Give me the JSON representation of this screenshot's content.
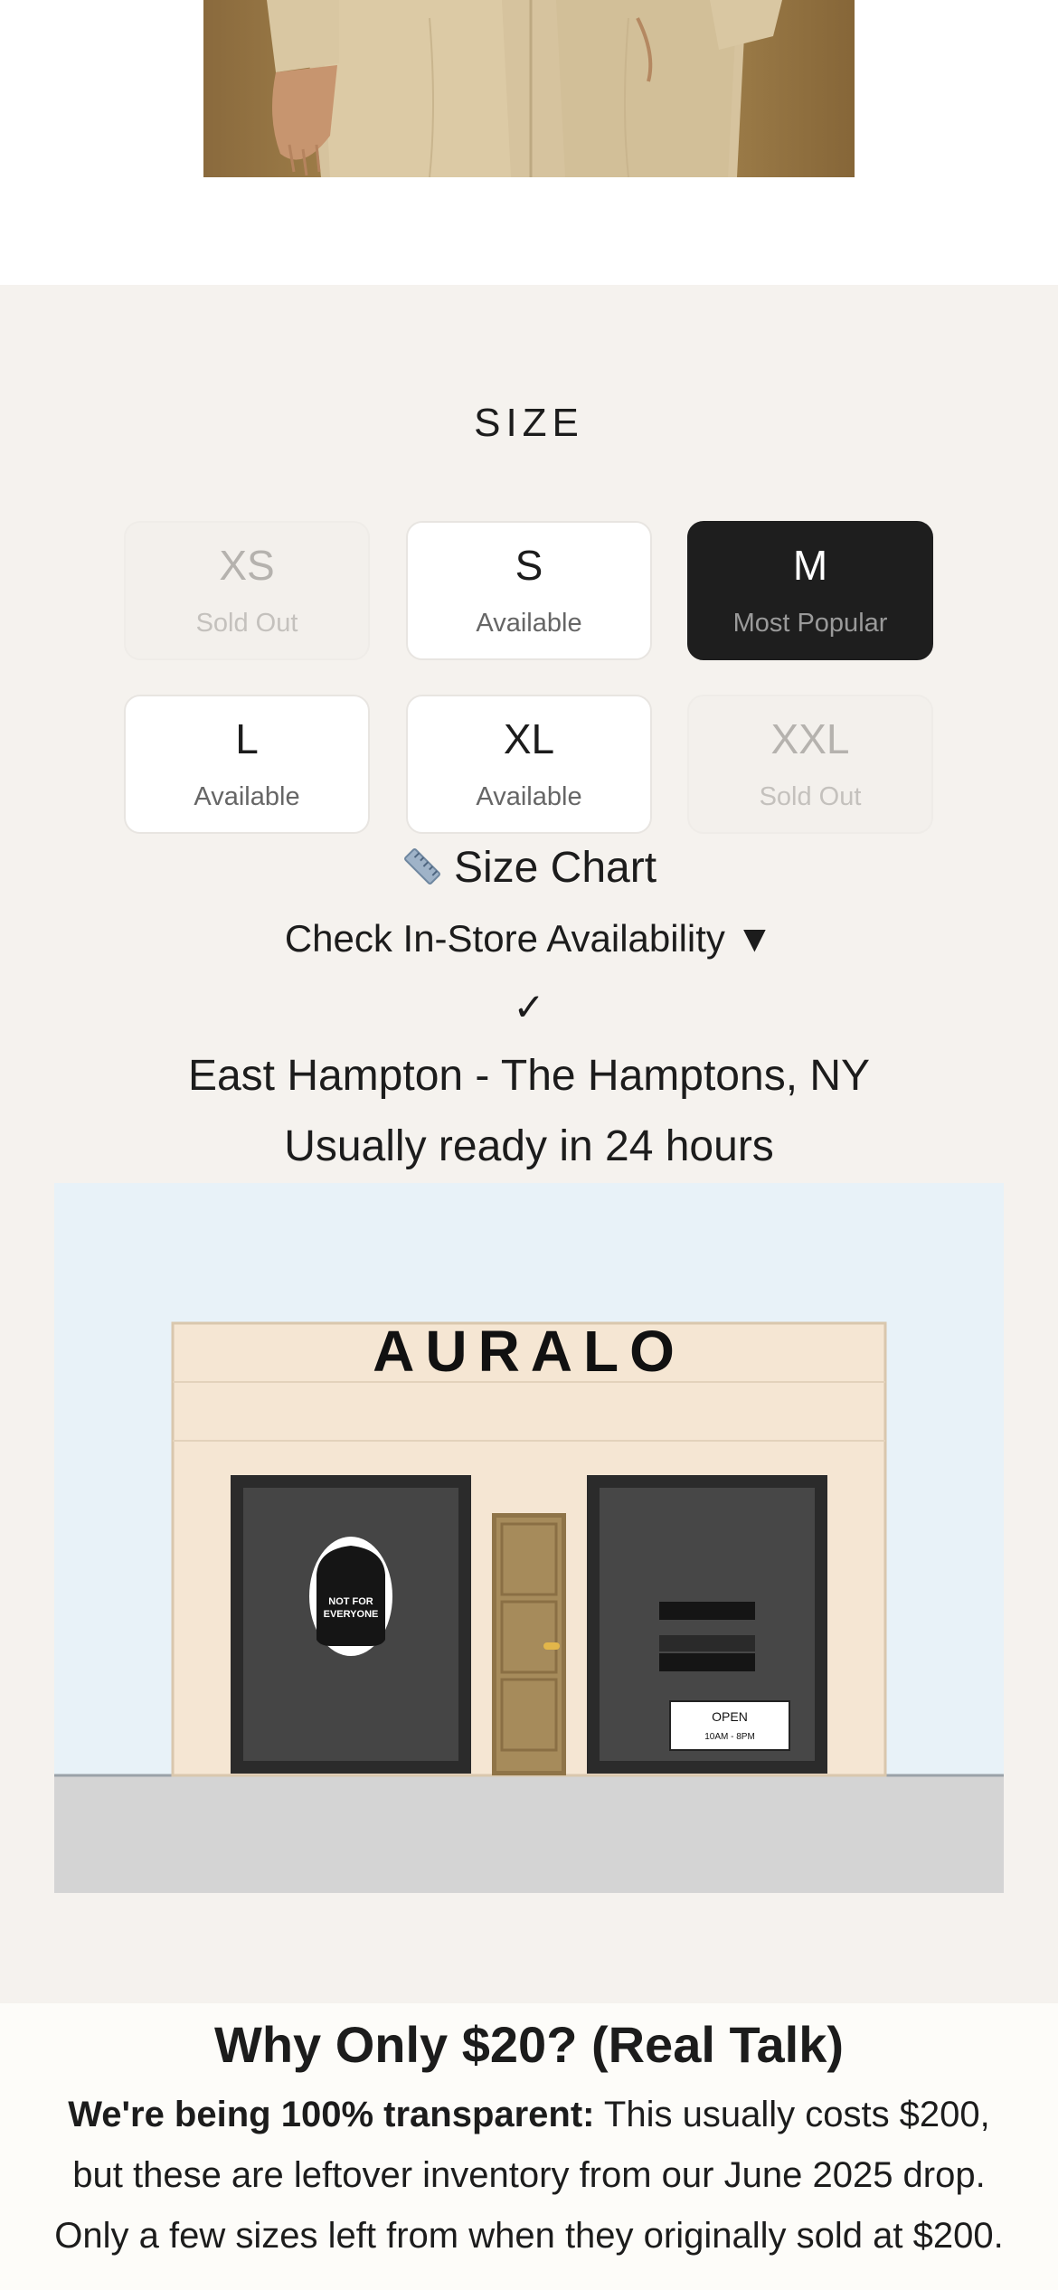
{
  "size_section": {
    "title": "SIZE",
    "sizes": [
      {
        "label": "XS",
        "status": "Sold Out"
      },
      {
        "label": "S",
        "status": "Available"
      },
      {
        "label": "M",
        "status": "Most Popular"
      },
      {
        "label": "L",
        "status": "Available"
      },
      {
        "label": "XL",
        "status": "Available"
      },
      {
        "label": "XXL",
        "status": "Sold Out"
      }
    ],
    "size_chart_label": "Size Chart",
    "instore_label": "Check In-Store Availability ▼",
    "check_mark": "✓",
    "store_location": "East Hampton - The Hamptons, NY",
    "ready_text": "Usually ready in 24 hours"
  },
  "storefront": {
    "brand_sign": "AURALO",
    "window_sign": "NOT FOR EVERYONE",
    "open_sign": "OPEN",
    "hours": "10AM - 8PM"
  },
  "why_section": {
    "heading": "Why Only $20? (Real Talk)",
    "lead_bold": "We're being 100% transparent:",
    "body": "This usually costs $200, but these are leftover inventory from our June 2025 drop. Only a few sizes left from when they originally sold at $200."
  },
  "colors": {
    "section_bg": "#f5f2ee",
    "selected_bg": "#1e1e1e",
    "sky": "#e8f2f8",
    "facade": "#f5e6d3",
    "door": "#a68b5b"
  }
}
